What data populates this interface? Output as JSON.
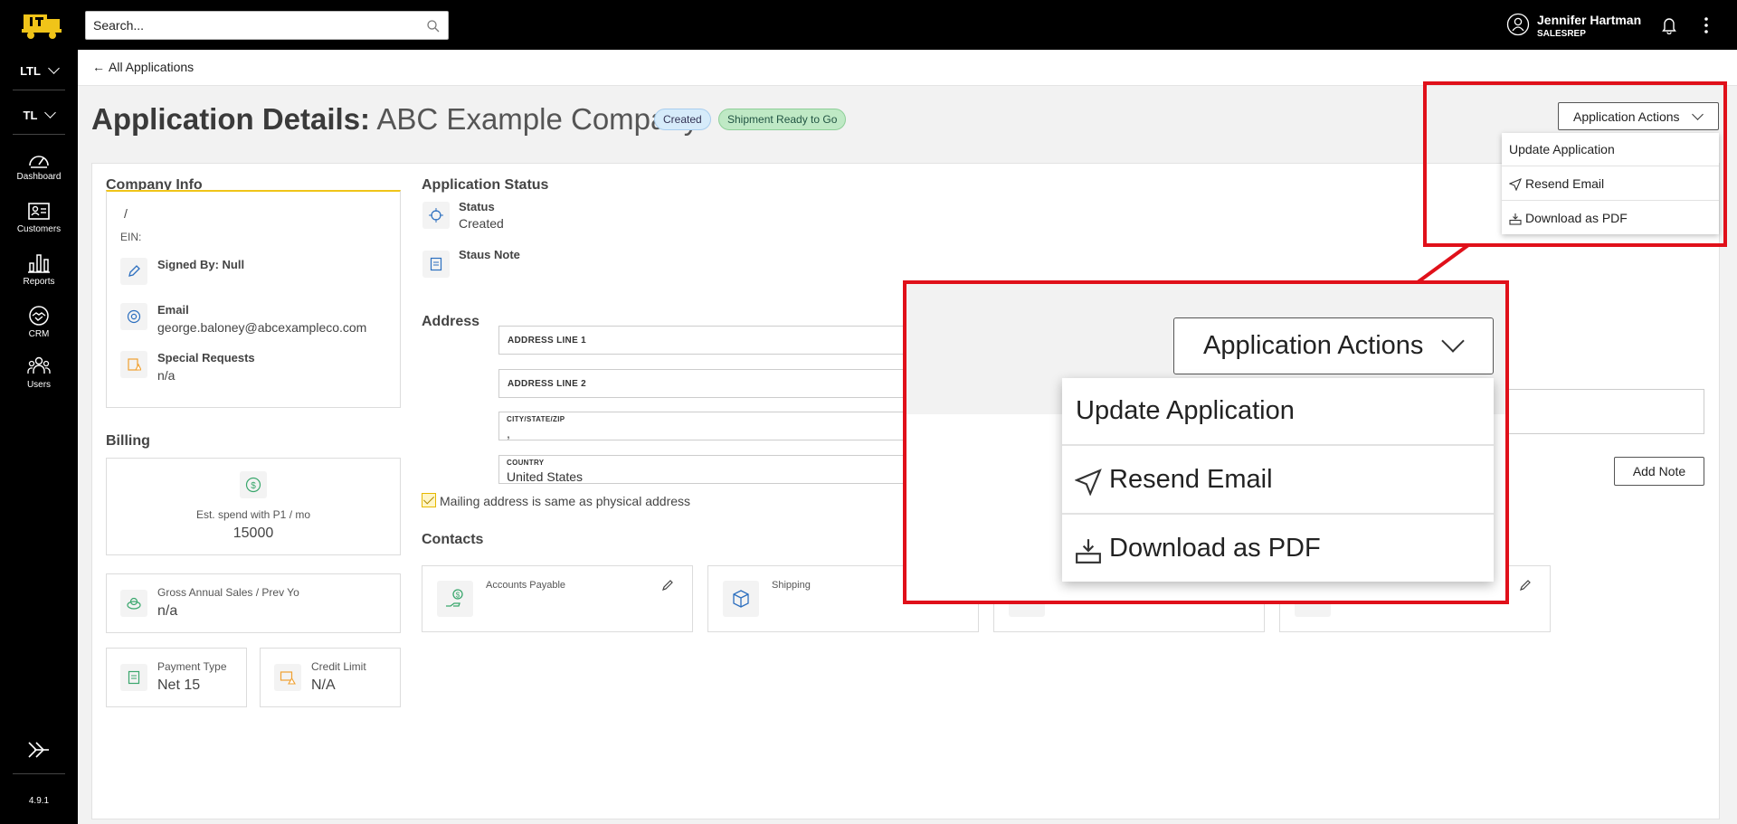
{
  "topbar": {
    "search_placeholder": "Search...",
    "user_name": "Jennifer Hartman",
    "user_role": "SALESREP"
  },
  "sidebar": {
    "dropdowns": [
      "LTL",
      "TL"
    ],
    "items": [
      {
        "label": "Dashboard",
        "icon": "gauge-icon"
      },
      {
        "label": "Customers",
        "icon": "id-card-icon"
      },
      {
        "label": "Reports",
        "icon": "bar-chart-icon"
      },
      {
        "label": "CRM",
        "icon": "handshake-icon"
      },
      {
        "label": "Users",
        "icon": "users-icon"
      }
    ],
    "version": "4.9.1"
  },
  "breadcrumb": {
    "label": "All Applications"
  },
  "header": {
    "title_prefix": "Application Details:",
    "company_name": "ABC Example Company",
    "badges": [
      "Created",
      "Shipment Ready to Go"
    ],
    "actions_label": "Application Actions"
  },
  "actions_menu": {
    "items": [
      "Update Application",
      "Resend Email",
      "Download as PDF"
    ]
  },
  "company_info": {
    "title": "Company Info",
    "slash": "/",
    "ein_label": "EIN:",
    "signed_by": "Signed By: Null",
    "email_label": "Email",
    "email_value": "george.baloney@abcexampleco.com",
    "special_label": "Special Requests",
    "special_value": "n/a"
  },
  "billing": {
    "title": "Billing",
    "est_label": "Est. spend with P1 / mo",
    "est_value": "15000",
    "gross_label": "Gross Annual Sales / Prev Yo",
    "gross_value": "n/a",
    "payment_label": "Payment Type",
    "payment_value": "Net 15",
    "credit_label": "Credit Limit",
    "credit_value": "N/A"
  },
  "application_status": {
    "title": "Application Status",
    "status_label": "Status",
    "status_value": "Created",
    "note_label": "Staus Note"
  },
  "address": {
    "title": "Address",
    "line1_placeholder": "ADDRESS LINE 1",
    "line2_placeholder": "ADDRESS LINE 2",
    "city_label": "CITY/STATE/ZIP",
    "city_value": ",",
    "country_label": "COUNTRY",
    "country_value": "United States",
    "mailing_same": "Mailing address is same as physical address"
  },
  "contacts": {
    "title": "Contacts",
    "cards": [
      {
        "label": "Accounts Payable"
      },
      {
        "label": "Shipping"
      },
      {
        "label": ""
      },
      {
        "label": ""
      }
    ]
  },
  "notes": {
    "add_label": "Add Note"
  },
  "colors": {
    "highlight": "#e0101a",
    "brand_yellow": "#f0c419",
    "icon_blue": "#2c6fbf",
    "icon_green": "#3aa76d",
    "icon_orange": "#f0a030"
  }
}
